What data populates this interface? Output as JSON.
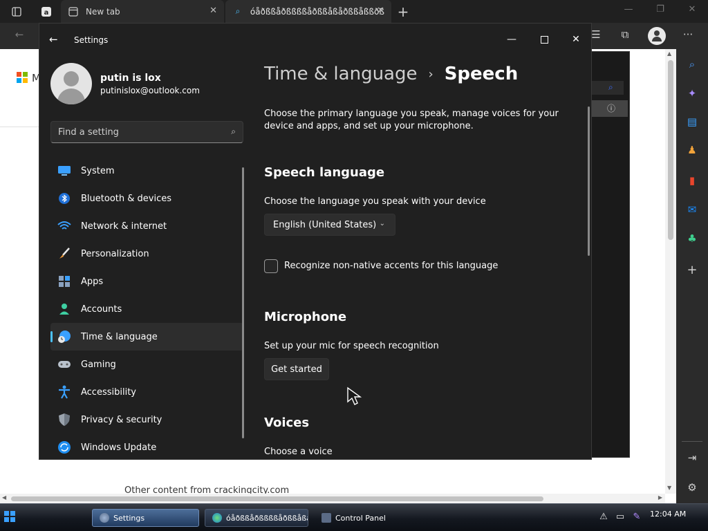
{
  "browser": {
    "tabs": [
      {
        "title": "New tab"
      },
      {
        "title": "óåðßßåðßßßßåðßßåßåðßßåßßðßßåßßå"
      }
    ]
  },
  "page": {
    "logo_text": "M",
    "footer_text": "Other content from crackingcity.com"
  },
  "settings": {
    "window_title": "Settings",
    "user": {
      "name": "putin is lox",
      "email": "putinislox@outlook.com"
    },
    "search": {
      "placeholder": "Find a setting"
    },
    "nav": [
      {
        "label": "System",
        "icon": "monitor-icon"
      },
      {
        "label": "Bluetooth & devices",
        "icon": "bluetooth-icon"
      },
      {
        "label": "Network & internet",
        "icon": "wifi-icon"
      },
      {
        "label": "Personalization",
        "icon": "brush-icon"
      },
      {
        "label": "Apps",
        "icon": "apps-icon"
      },
      {
        "label": "Accounts",
        "icon": "account-icon"
      },
      {
        "label": "Time & language",
        "icon": "globe-clock-icon",
        "active": true
      },
      {
        "label": "Gaming",
        "icon": "gamepad-icon"
      },
      {
        "label": "Accessibility",
        "icon": "accessibility-icon"
      },
      {
        "label": "Privacy & security",
        "icon": "shield-icon"
      },
      {
        "label": "Windows Update",
        "icon": "update-icon"
      }
    ],
    "breadcrumb": {
      "parent": "Time & language",
      "current": "Speech"
    },
    "description": "Choose the primary language you speak, manage voices for your device and apps, and set up your microphone.",
    "speech_language": {
      "heading": "Speech language",
      "subtitle": "Choose the language you speak with your device",
      "selected": "English (United States)",
      "checkbox_label": "Recognize non-native accents for this language"
    },
    "microphone": {
      "heading": "Microphone",
      "subtitle": "Set up your mic for speech recognition",
      "button": "Get started"
    },
    "voices": {
      "heading": "Voices",
      "subtitle": "Choose a voice"
    }
  },
  "taskbar": {
    "items": [
      {
        "label": "Settings"
      },
      {
        "label": "óåðßßåðßßßßåðßßåßå..."
      },
      {
        "label": "Control Panel"
      }
    ],
    "clock": "12:04 AM"
  },
  "colors": {
    "accent": "#4cc2ff",
    "window_bg": "#202020",
    "control_bg": "#2d2d2d"
  }
}
